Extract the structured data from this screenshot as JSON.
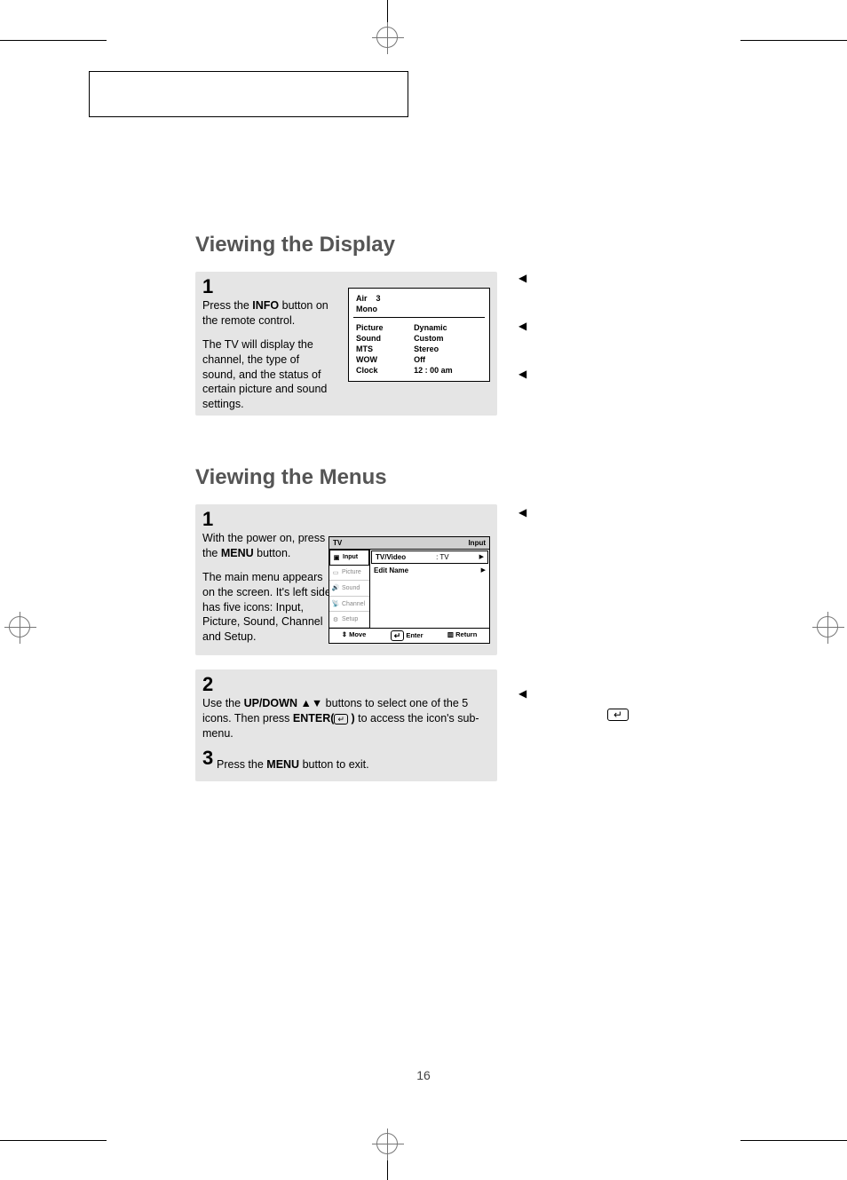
{
  "page_number": "16",
  "section1": {
    "title": "Viewing the Display",
    "step": "1",
    "para1_a": "Press the ",
    "para1_b": "INFO",
    "para1_c": " button on the remote control.",
    "para2": "The TV will display the channel, the type of sound, and the status of certain picture and sound settings."
  },
  "osd_info": {
    "line1_a": "Air",
    "line1_b": "3",
    "line2": "Mono",
    "rows": [
      {
        "k": "Picture",
        "v": "Dynamic"
      },
      {
        "k": "Sound",
        "v": "Custom"
      },
      {
        "k": "MTS",
        "v": "Stereo"
      },
      {
        "k": "WOW",
        "v": "Off"
      },
      {
        "k": "Clock",
        "v": "12 : 00   am"
      }
    ]
  },
  "section2": {
    "title": "Viewing the Menus",
    "step1": "1",
    "p1a": "With the power on, press the ",
    "p1b": "MENU",
    "p1c": " button.",
    "p2": "The main menu appears on the screen. It's left side has five icons: Input, Picture, Sound, Channel and Setup.",
    "step2": "2",
    "s2a": "Use the ",
    "s2b": "UP/DOWN",
    "s2c": " ▲▼  buttons to select one of the 5 icons. Then press ",
    "s2d": "ENTER(",
    "s2e": " )",
    "s2f": " to access the icon's sub-menu.",
    "step3": "3",
    "s3a": "Press the ",
    "s3b": "MENU",
    "s3c": " button to exit."
  },
  "osd_menu": {
    "title_left": "TV",
    "title_right": "Input",
    "side": [
      "Input",
      "Picture",
      "Sound",
      "Channel",
      "Setup"
    ],
    "row1_l": "TV/Video",
    "row1_c": ":   TV",
    "row2_l": "Edit Name",
    "foot": {
      "move": "Move",
      "enter": "Enter",
      "return": "Return"
    }
  },
  "enter_glyph": "↵"
}
